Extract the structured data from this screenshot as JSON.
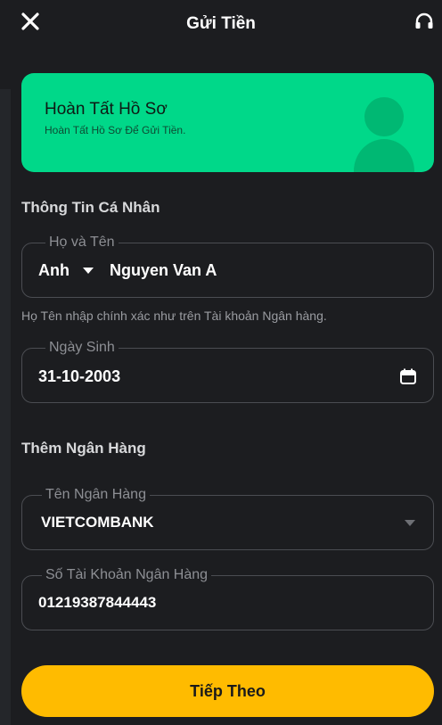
{
  "header": {
    "title": "Gửi Tiền",
    "close_icon": "close-icon",
    "support_icon": "headset-icon"
  },
  "banner": {
    "title": "Hoàn Tất Hồ Sơ",
    "subtitle": "Hoàn Tất Hồ Sơ Để Gửi Tiền.",
    "icon": "user-avatar-icon",
    "color": "#00d889"
  },
  "personal": {
    "section_title": "Thông Tin Cá Nhân",
    "name_field": {
      "label": "Họ và Tên",
      "title_select": "Anh",
      "value": "Nguyen Van A"
    },
    "helper": "Họ Tên nhập chính xác như trên Tài khoản Ngân hàng.",
    "dob_field": {
      "label": "Ngày Sinh",
      "value": "31-10-2003",
      "icon": "calendar-icon"
    }
  },
  "bank": {
    "section_title": "Thêm Ngân Hàng",
    "bank_name_field": {
      "label": "Tên Ngân Hàng",
      "value": "VIETCOMBANK"
    },
    "account_field": {
      "label": "Số Tài Khoản Ngân Hàng",
      "value": "01219387844443"
    }
  },
  "next_button": {
    "label": "Tiếp Theo",
    "color": "#ffbb00"
  }
}
